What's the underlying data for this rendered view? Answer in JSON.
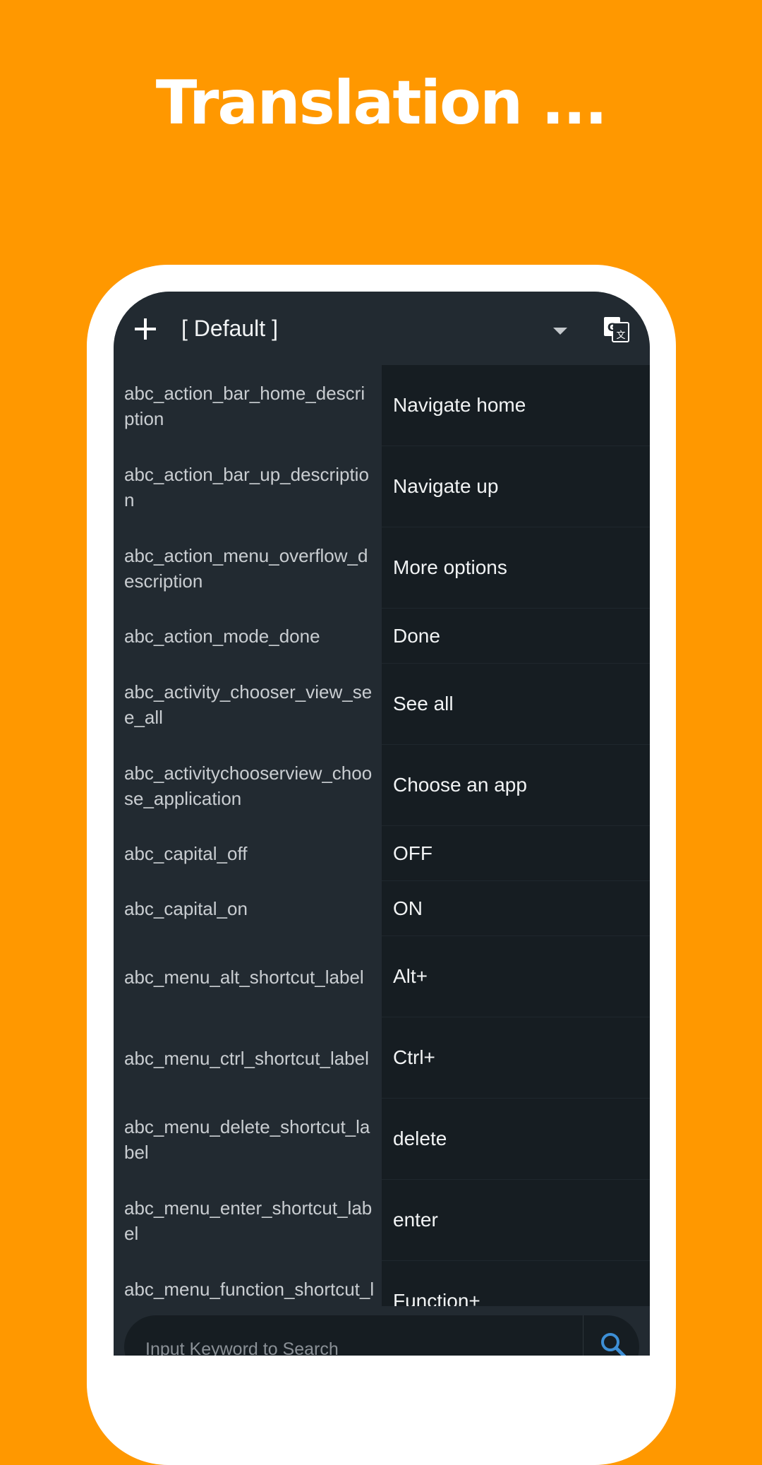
{
  "headline": "Translation ...",
  "toolbar": {
    "add_icon": "plus-icon",
    "profile_selected": "[ Default ]",
    "dropdown_icon": "dropdown-arrow-icon",
    "translate_icon": "google-translate-icon"
  },
  "rows": [
    {
      "key": "abc_action_bar_home_description",
      "value": "Navigate home"
    },
    {
      "key": "abc_action_bar_up_description",
      "value": "Navigate up"
    },
    {
      "key": "abc_action_menu_overflow_description",
      "value": "More options"
    },
    {
      "key": "abc_action_mode_done",
      "value": "Done"
    },
    {
      "key": "abc_activity_chooser_view_see_all",
      "value": "See all"
    },
    {
      "key": "abc_activitychooserview_choose_application",
      "value": "Choose an app"
    },
    {
      "key": "abc_capital_off",
      "value": "OFF"
    },
    {
      "key": "abc_capital_on",
      "value": "ON"
    },
    {
      "key": "abc_menu_alt_shortcut_label",
      "value": "Alt+"
    },
    {
      "key": "abc_menu_ctrl_shortcut_label",
      "value": "Ctrl+"
    },
    {
      "key": "abc_menu_delete_shortcut_label",
      "value": "delete"
    },
    {
      "key": "abc_menu_enter_shortcut_label",
      "value": "enter"
    },
    {
      "key": "abc_menu_function_shortcut_label",
      "value": "Function+"
    }
  ],
  "search": {
    "placeholder": "Input Keyword to Search",
    "button_icon": "search-icon"
  },
  "colors": {
    "background": "#FF9800",
    "screen": "#222a31",
    "value_column": "#161d22",
    "search_icon": "#3d8fd6"
  }
}
